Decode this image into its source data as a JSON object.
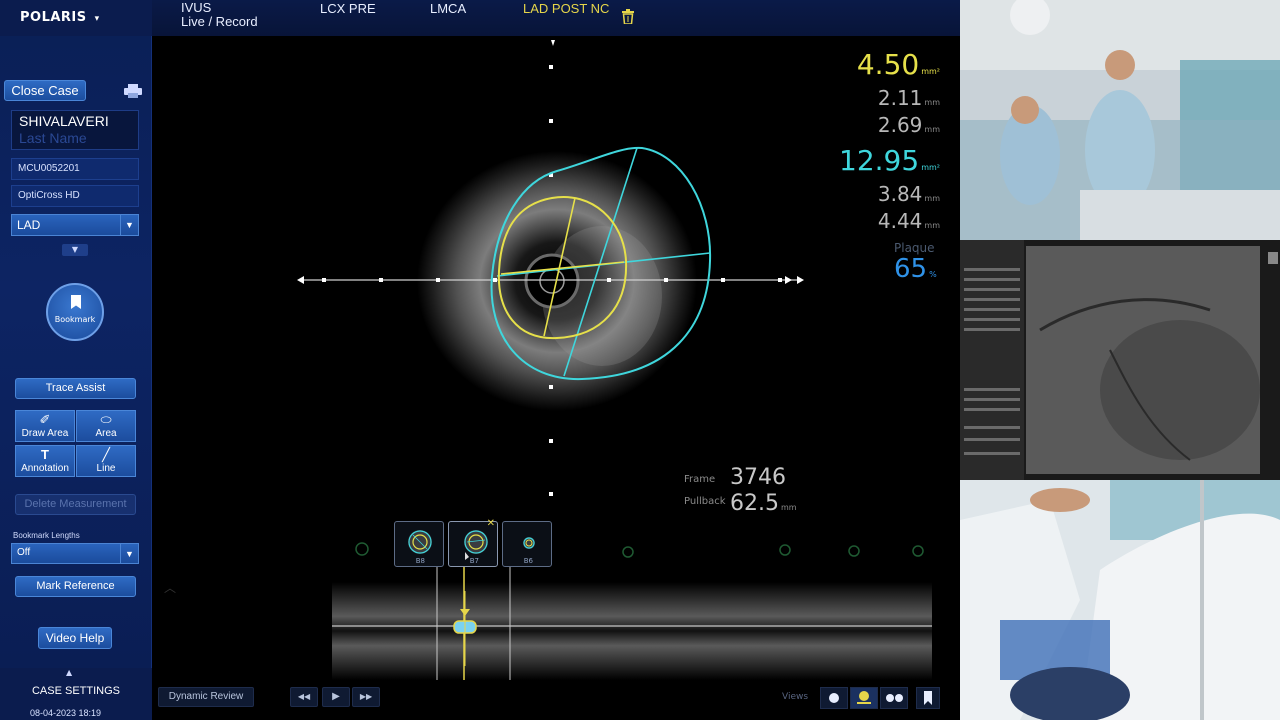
{
  "sidebar": {
    "brand": "POLARIS",
    "brand_caret": "▾",
    "close_case": "Close Case",
    "patient_first": "SHIVALAVERI",
    "patient_last_placeholder": "Last Name",
    "patient_id": "MCU0052201",
    "catheter": "OptiCross HD",
    "vessel": "LAD",
    "bookmark": "Bookmark",
    "trace_assist": "Trace Assist",
    "tools": [
      {
        "label": "Draw Area",
        "glyph": "✐"
      },
      {
        "label": "Area",
        "glyph": "⬭"
      },
      {
        "label": "Annotation",
        "glyph": "T"
      },
      {
        "label": "Line",
        "glyph": "╱"
      }
    ],
    "delete_measurement": "Delete Measurement",
    "bookmark_lengths_label": "Bookmark Lengths",
    "bookmark_lengths_value": "Off",
    "mark_reference": "Mark Reference",
    "video_help": "Video Help",
    "case_settings": "CASE SETTINGS",
    "datetime": "08-04-2023 18:19"
  },
  "tabs": [
    {
      "label": "IVUS",
      "label2": "Live / Record"
    },
    {
      "label": "LCX PRE"
    },
    {
      "label": "LMCA"
    },
    {
      "label": "LAD POST NC",
      "active": true
    }
  ],
  "measurements": {
    "lumen": {
      "area": "4.50",
      "area_unit": "mm²",
      "min": "2.11",
      "max": "2.69",
      "unit": "mm",
      "color": "#e6e04a"
    },
    "vessel": {
      "area": "12.95",
      "area_unit": "mm²",
      "min": "3.84",
      "max": "4.44",
      "unit": "mm",
      "color": "#3fd6dc"
    },
    "plaque_label": "Plaque",
    "plaque_value": "65",
    "plaque_unit": "%"
  },
  "frame": {
    "frame_label": "Frame",
    "frame_value": "3746",
    "pullback_label": "Pullback",
    "pullback_value": "62.5",
    "pullback_unit": "mm"
  },
  "thumbnails": [
    {
      "num": "B8"
    },
    {
      "num": "B7"
    },
    {
      "num": "B6"
    }
  ],
  "bottom": {
    "dynamic_review": "Dynamic Review",
    "rewind": "◀◀",
    "play": "▶",
    "forward": "▶▶",
    "views_label": "Views"
  }
}
